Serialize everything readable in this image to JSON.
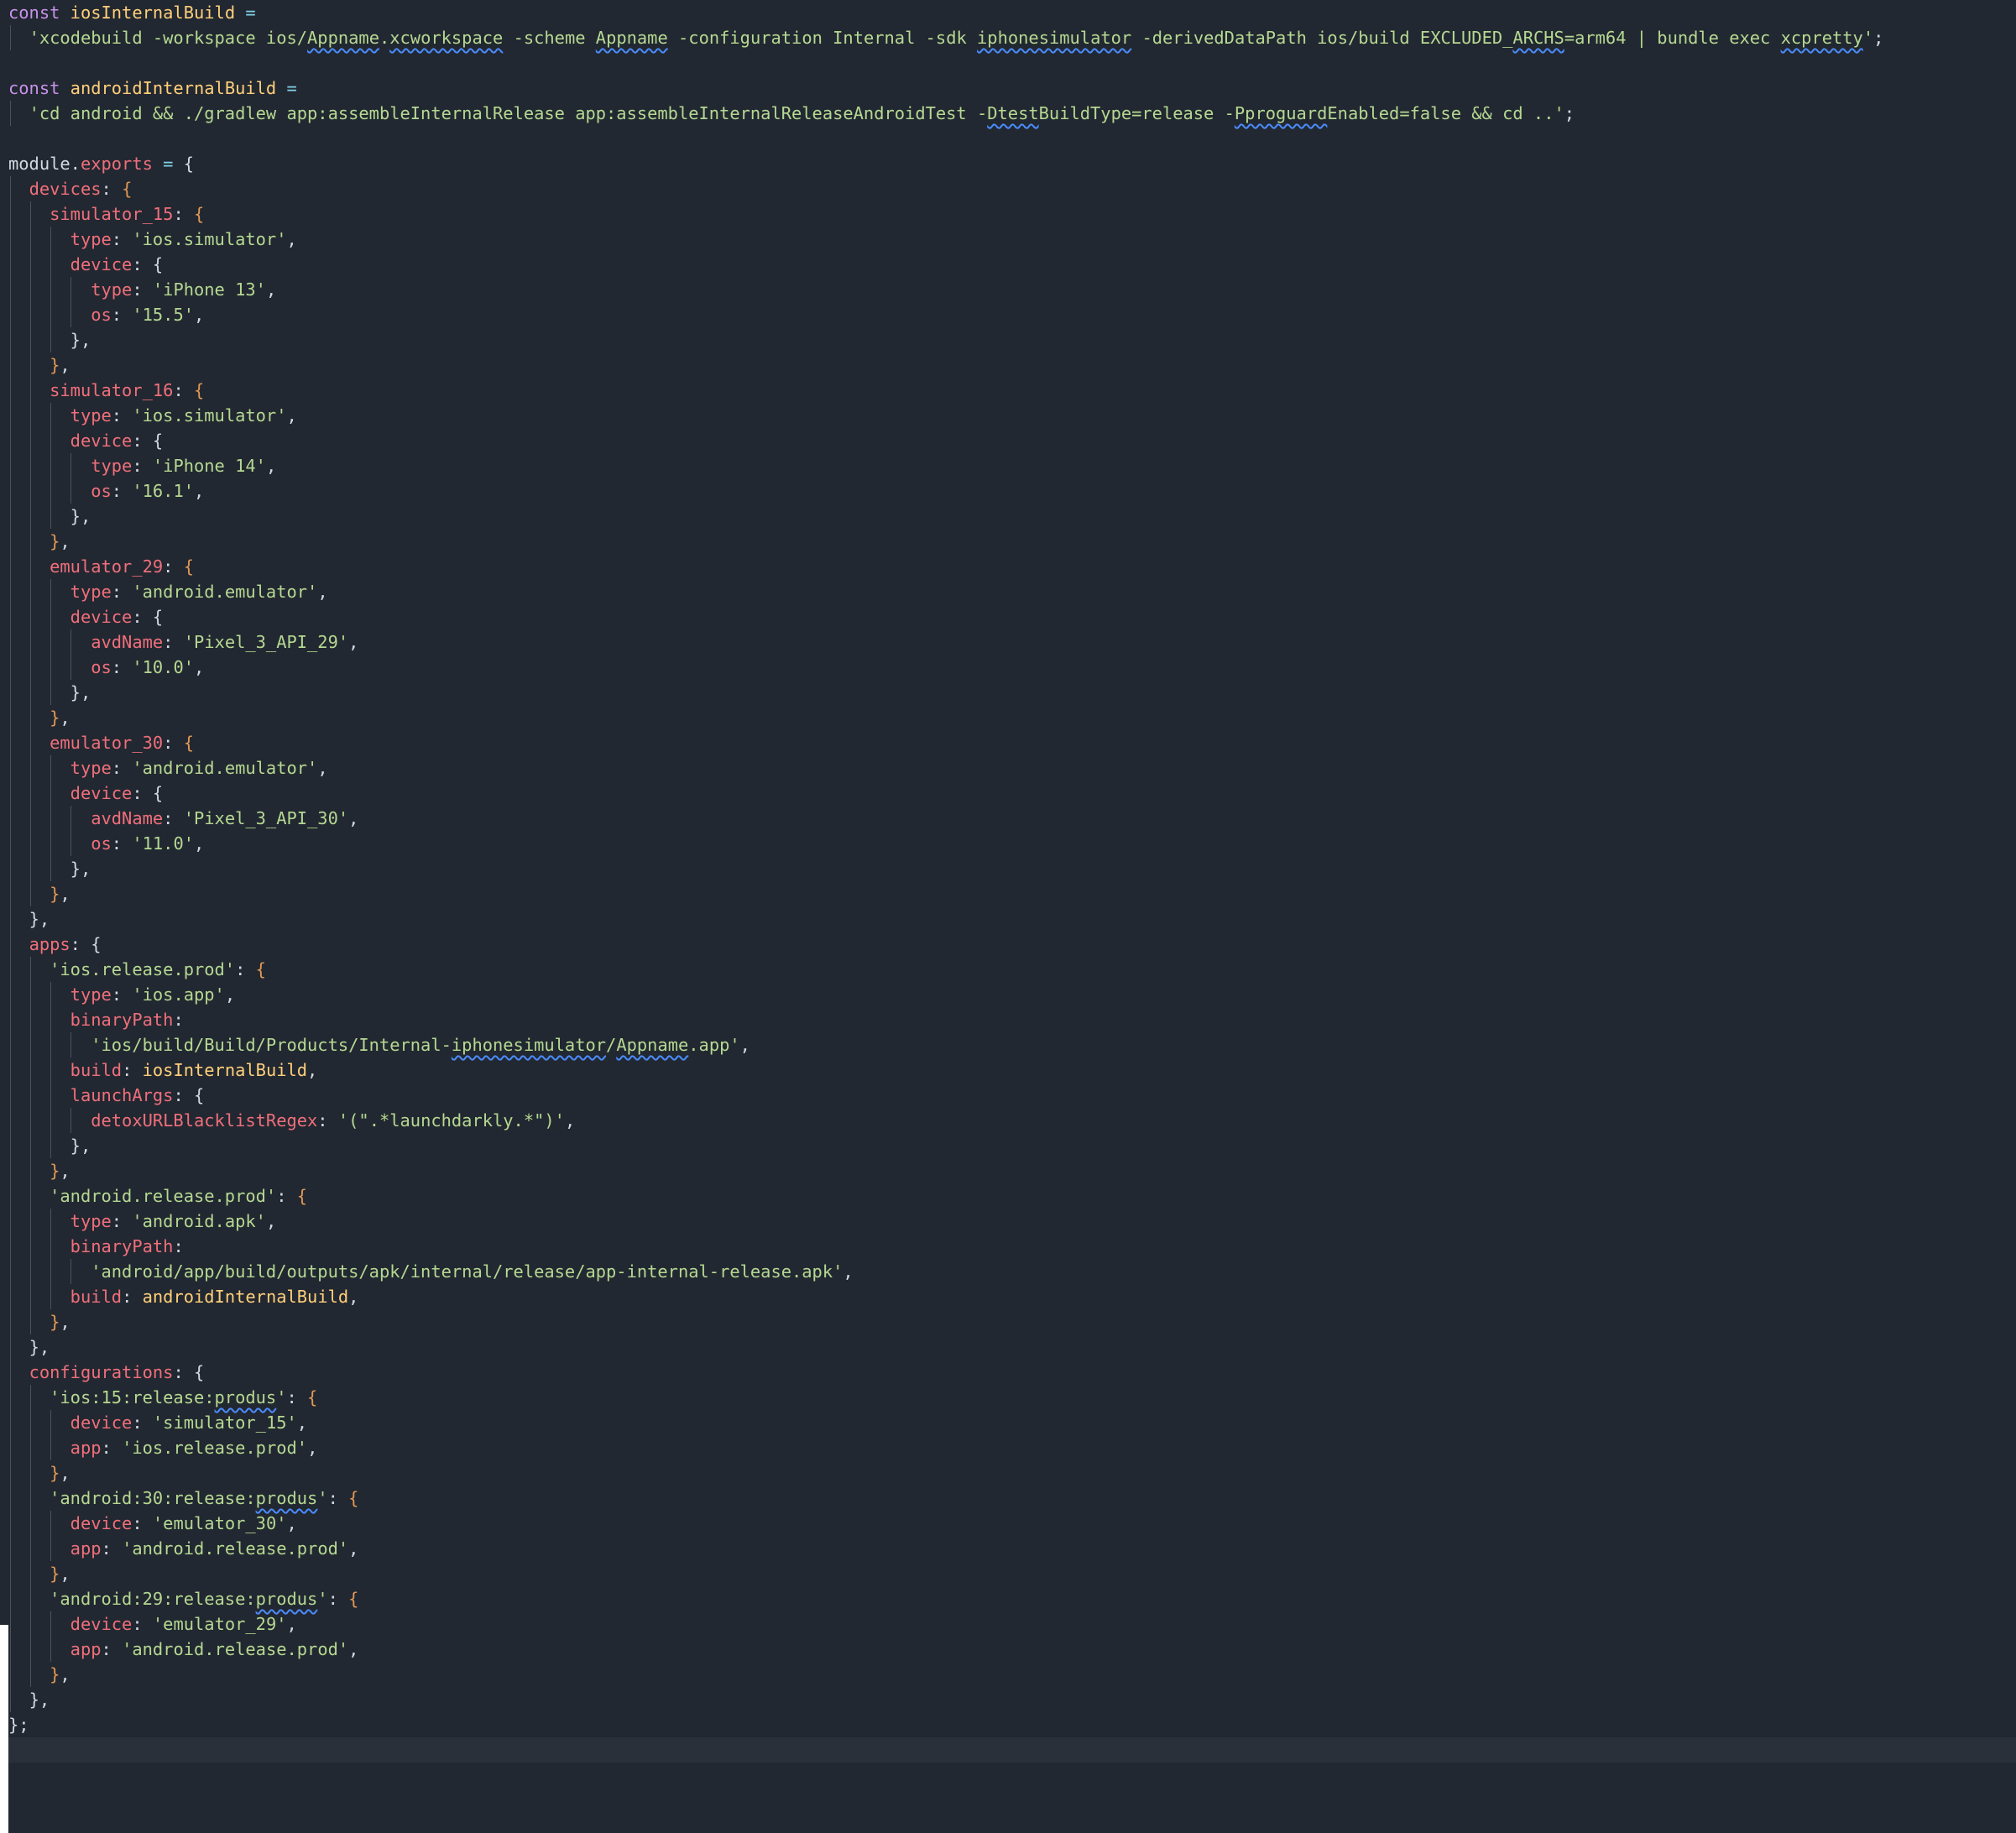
{
  "editor": {
    "lines": [
      [
        {
          "t": "const",
          "c": "kw"
        },
        {
          "t": " "
        },
        {
          "t": "iosInternalBuild",
          "c": "cn"
        },
        {
          "t": " =",
          " c": "op"
        }
      ],
      [
        {
          "t": "  "
        },
        {
          "t": "'xcodebuild -workspace ios/",
          "c": "st"
        },
        {
          "t": "Appname",
          "c": "st",
          "sq": true
        },
        {
          "t": ".",
          "c": "st"
        },
        {
          "t": "xcworkspace",
          "c": "st",
          "sq": true
        },
        {
          "t": " -scheme ",
          "c": "st"
        },
        {
          "t": "Appname",
          "c": "st",
          "sq": true
        },
        {
          "t": " -configuration Internal -sdk ",
          "c": "st"
        },
        {
          "t": "iphonesimulator",
          "c": "st",
          "sq": true
        },
        {
          "t": " -derivedDataPath ios/build EXCLUDED_",
          "c": "st"
        },
        {
          "t": "ARCHS",
          "c": "st",
          "sq": true
        },
        {
          "t": "=arm64 | bundle exec ",
          "c": "st"
        },
        {
          "t": "xcpretty",
          "c": "st",
          "sq": true
        },
        {
          "t": "'",
          "c": "st"
        },
        {
          "t": ";",
          "c": "pu"
        }
      ],
      [],
      [
        {
          "t": "const",
          "c": "kw"
        },
        {
          "t": " "
        },
        {
          "t": "androidInternalBuild",
          "c": "cn"
        },
        {
          "t": " =",
          "c": "op"
        }
      ],
      [
        {
          "t": "  "
        },
        {
          "t": "'cd android && ./gradlew app:assembleInternalRelease app:assembleInternalReleaseAndroidTest -",
          "c": "st"
        },
        {
          "t": "Dtest",
          "c": "st",
          "sq": true
        },
        {
          "t": "BuildType=release -",
          "c": "st"
        },
        {
          "t": "Pproguard",
          "c": "st",
          "sq": true
        },
        {
          "t": "Enabled=false && cd ..'",
          "c": "st"
        },
        {
          "t": ";",
          "c": "pu"
        }
      ],
      [],
      [
        {
          "t": "module",
          "c": "pu"
        },
        {
          "t": ".",
          "c": "pu"
        },
        {
          "t": "exports",
          "c": "pr"
        },
        {
          "t": " = ",
          "c": "op"
        },
        {
          "t": "{",
          "c": "pu"
        }
      ],
      [
        {
          "t": "  "
        },
        {
          "t": "devices",
          "c": "pr"
        },
        {
          "t": ": ",
          "c": "pu"
        },
        {
          "t": "{",
          "c": "b2"
        }
      ],
      [
        {
          "t": "    "
        },
        {
          "t": "simulator_15",
          "c": "pr"
        },
        {
          "t": ": ",
          "c": "pu"
        },
        {
          "t": "{",
          "c": "b2"
        }
      ],
      [
        {
          "t": "      "
        },
        {
          "t": "type",
          "c": "pr"
        },
        {
          "t": ": ",
          "c": "pu"
        },
        {
          "t": "'ios.simulator'",
          "c": "st"
        },
        {
          "t": ",",
          "c": "pu"
        }
      ],
      [
        {
          "t": "      "
        },
        {
          "t": "device",
          "c": "pr"
        },
        {
          "t": ": {",
          "c": "pu"
        }
      ],
      [
        {
          "t": "        "
        },
        {
          "t": "type",
          "c": "pr"
        },
        {
          "t": ": ",
          "c": "pu"
        },
        {
          "t": "'iPhone 13'",
          "c": "st"
        },
        {
          "t": ",",
          "c": "pu"
        }
      ],
      [
        {
          "t": "        "
        },
        {
          "t": "os",
          "c": "pr"
        },
        {
          "t": ": ",
          "c": "pu"
        },
        {
          "t": "'15.5'",
          "c": "st"
        },
        {
          "t": ",",
          "c": "pu"
        }
      ],
      [
        {
          "t": "      "
        },
        {
          "t": "},",
          "c": "pu"
        }
      ],
      [
        {
          "t": "    "
        },
        {
          "t": "}",
          "c": "b2"
        },
        {
          "t": ",",
          "c": "pu"
        }
      ],
      [
        {
          "t": "    "
        },
        {
          "t": "simulator_16",
          "c": "pr"
        },
        {
          "t": ": ",
          "c": "pu"
        },
        {
          "t": "{",
          "c": "b2"
        }
      ],
      [
        {
          "t": "      "
        },
        {
          "t": "type",
          "c": "pr"
        },
        {
          "t": ": ",
          "c": "pu"
        },
        {
          "t": "'ios.simulator'",
          "c": "st"
        },
        {
          "t": ",",
          "c": "pu"
        }
      ],
      [
        {
          "t": "      "
        },
        {
          "t": "device",
          "c": "pr"
        },
        {
          "t": ": {",
          "c": "pu"
        }
      ],
      [
        {
          "t": "        "
        },
        {
          "t": "type",
          "c": "pr"
        },
        {
          "t": ": ",
          "c": "pu"
        },
        {
          "t": "'iPhone 14'",
          "c": "st"
        },
        {
          "t": ",",
          "c": "pu"
        }
      ],
      [
        {
          "t": "        "
        },
        {
          "t": "os",
          "c": "pr"
        },
        {
          "t": ": ",
          "c": "pu"
        },
        {
          "t": "'16.1'",
          "c": "st"
        },
        {
          "t": ",",
          "c": "pu"
        }
      ],
      [
        {
          "t": "      "
        },
        {
          "t": "},",
          "c": "pu"
        }
      ],
      [
        {
          "t": "    "
        },
        {
          "t": "}",
          "c": "b2"
        },
        {
          "t": ",",
          "c": "pu"
        }
      ],
      [
        {
          "t": "    "
        },
        {
          "t": "emulator_29",
          "c": "pr"
        },
        {
          "t": ": ",
          "c": "pu"
        },
        {
          "t": "{",
          "c": "b2"
        }
      ],
      [
        {
          "t": "      "
        },
        {
          "t": "type",
          "c": "pr"
        },
        {
          "t": ": ",
          "c": "pu"
        },
        {
          "t": "'android.emulator'",
          "c": "st"
        },
        {
          "t": ",",
          "c": "pu"
        }
      ],
      [
        {
          "t": "      "
        },
        {
          "t": "device",
          "c": "pr"
        },
        {
          "t": ": {",
          "c": "pu"
        }
      ],
      [
        {
          "t": "        "
        },
        {
          "t": "avdName",
          "c": "pr"
        },
        {
          "t": ": ",
          "c": "pu"
        },
        {
          "t": "'Pixel_3_API_29'",
          "c": "st"
        },
        {
          "t": ",",
          "c": "pu"
        }
      ],
      [
        {
          "t": "        "
        },
        {
          "t": "os",
          "c": "pr"
        },
        {
          "t": ": ",
          "c": "pu"
        },
        {
          "t": "'10.0'",
          "c": "st"
        },
        {
          "t": ",",
          "c": "pu"
        }
      ],
      [
        {
          "t": "      "
        },
        {
          "t": "},",
          "c": "pu"
        }
      ],
      [
        {
          "t": "    "
        },
        {
          "t": "}",
          "c": "b2"
        },
        {
          "t": ",",
          "c": "pu"
        }
      ],
      [
        {
          "t": "    "
        },
        {
          "t": "emulator_30",
          "c": "pr"
        },
        {
          "t": ": ",
          "c": "pu"
        },
        {
          "t": "{",
          "c": "b2"
        }
      ],
      [
        {
          "t": "      "
        },
        {
          "t": "type",
          "c": "pr"
        },
        {
          "t": ": ",
          "c": "pu"
        },
        {
          "t": "'android.emulator'",
          "c": "st"
        },
        {
          "t": ",",
          "c": "pu"
        }
      ],
      [
        {
          "t": "      "
        },
        {
          "t": "device",
          "c": "pr"
        },
        {
          "t": ": {",
          "c": "pu"
        }
      ],
      [
        {
          "t": "        "
        },
        {
          "t": "avdName",
          "c": "pr"
        },
        {
          "t": ": ",
          "c": "pu"
        },
        {
          "t": "'Pixel_3_API_30'",
          "c": "st"
        },
        {
          "t": ",",
          "c": "pu"
        }
      ],
      [
        {
          "t": "        "
        },
        {
          "t": "os",
          "c": "pr"
        },
        {
          "t": ": ",
          "c": "pu"
        },
        {
          "t": "'11.0'",
          "c": "st"
        },
        {
          "t": ",",
          "c": "pu"
        }
      ],
      [
        {
          "t": "      "
        },
        {
          "t": "},",
          "c": "pu"
        }
      ],
      [
        {
          "t": "    "
        },
        {
          "t": "}",
          "c": "b2"
        },
        {
          "t": ",",
          "c": "pu"
        }
      ],
      [
        {
          "t": "  "
        },
        {
          "t": "},",
          "c": "pu"
        }
      ],
      [
        {
          "t": "  "
        },
        {
          "t": "apps",
          "c": "pr"
        },
        {
          "t": ": {",
          "c": "pu"
        }
      ],
      [
        {
          "t": "    "
        },
        {
          "t": "'ios.release.prod'",
          "c": "st"
        },
        {
          "t": ": ",
          "c": "pu"
        },
        {
          "t": "{",
          "c": "b2"
        }
      ],
      [
        {
          "t": "      "
        },
        {
          "t": "type",
          "c": "pr"
        },
        {
          "t": ": ",
          "c": "pu"
        },
        {
          "t": "'ios.app'",
          "c": "st"
        },
        {
          "t": ",",
          "c": "pu"
        }
      ],
      [
        {
          "t": "      "
        },
        {
          "t": "binaryPath",
          "c": "pr"
        },
        {
          "t": ":",
          "c": "pu"
        }
      ],
      [
        {
          "t": "        "
        },
        {
          "t": "'ios/build/Build/Products/Internal-",
          "c": "st"
        },
        {
          "t": "iphonesimulator",
          "c": "st",
          "sq": true
        },
        {
          "t": "/",
          "c": "st"
        },
        {
          "t": "Appname",
          "c": "st",
          "sq": true
        },
        {
          "t": ".app'",
          "c": "st"
        },
        {
          "t": ",",
          "c": "pu"
        }
      ],
      [
        {
          "t": "      "
        },
        {
          "t": "build",
          "c": "pr"
        },
        {
          "t": ": ",
          "c": "pu"
        },
        {
          "t": "iosInternalBuild",
          "c": "cn"
        },
        {
          "t": ",",
          "c": "pu"
        }
      ],
      [
        {
          "t": "      "
        },
        {
          "t": "launchArgs",
          "c": "pr"
        },
        {
          "t": ": {",
          "c": "pu"
        }
      ],
      [
        {
          "t": "        "
        },
        {
          "t": "detoxURLBlacklistRegex",
          "c": "pr"
        },
        {
          "t": ": ",
          "c": "pu"
        },
        {
          "t": "'(\".*launchdarkly.*\")'",
          "c": "st"
        },
        {
          "t": ",",
          "c": "pu"
        }
      ],
      [
        {
          "t": "      "
        },
        {
          "t": "},",
          "c": "pu"
        }
      ],
      [
        {
          "t": "    "
        },
        {
          "t": "}",
          "c": "b2"
        },
        {
          "t": ",",
          "c": "pu"
        }
      ],
      [
        {
          "t": "    "
        },
        {
          "t": "'android.release.prod'",
          "c": "st"
        },
        {
          "t": ": ",
          "c": "pu"
        },
        {
          "t": "{",
          "c": "b2"
        }
      ],
      [
        {
          "t": "      "
        },
        {
          "t": "type",
          "c": "pr"
        },
        {
          "t": ": ",
          "c": "pu"
        },
        {
          "t": "'android.apk'",
          "c": "st"
        },
        {
          "t": ",",
          "c": "pu"
        }
      ],
      [
        {
          "t": "      "
        },
        {
          "t": "binaryPath",
          "c": "pr"
        },
        {
          "t": ":",
          "c": "pu"
        }
      ],
      [
        {
          "t": "        "
        },
        {
          "t": "'android/app/build/outputs/apk/internal/release/app-internal-release.apk'",
          "c": "st"
        },
        {
          "t": ",",
          "c": "pu"
        }
      ],
      [
        {
          "t": "      "
        },
        {
          "t": "build",
          "c": "pr"
        },
        {
          "t": ": ",
          "c": "pu"
        },
        {
          "t": "androidInternalBuild",
          "c": "cn"
        },
        {
          "t": ",",
          "c": "pu"
        }
      ],
      [
        {
          "t": "    "
        },
        {
          "t": "}",
          "c": "b2"
        },
        {
          "t": ",",
          "c": "pu"
        }
      ],
      [
        {
          "t": "  "
        },
        {
          "t": "},",
          "c": "pu"
        }
      ],
      [
        {
          "t": "  "
        },
        {
          "t": "configurations",
          "c": "pr"
        },
        {
          "t": ": {",
          "c": "pu"
        }
      ],
      [
        {
          "t": "    "
        },
        {
          "t": "'ios:15:release:",
          "c": "st"
        },
        {
          "t": "produs",
          "c": "st",
          "sq": true
        },
        {
          "t": "'",
          "c": "st"
        },
        {
          "t": ": ",
          "c": "pu"
        },
        {
          "t": "{",
          "c": "b2"
        }
      ],
      [
        {
          "t": "      "
        },
        {
          "t": "device",
          "c": "pr"
        },
        {
          "t": ": ",
          "c": "pu"
        },
        {
          "t": "'simulator_15'",
          "c": "st"
        },
        {
          "t": ",",
          "c": "pu"
        }
      ],
      [
        {
          "t": "      "
        },
        {
          "t": "app",
          "c": "pr"
        },
        {
          "t": ": ",
          "c": "pu"
        },
        {
          "t": "'ios.release.prod'",
          "c": "st"
        },
        {
          "t": ",",
          "c": "pu"
        }
      ],
      [
        {
          "t": "    "
        },
        {
          "t": "}",
          "c": "b2"
        },
        {
          "t": ",",
          "c": "pu"
        }
      ],
      [
        {
          "t": "    "
        },
        {
          "t": "'android:30:release:",
          "c": "st"
        },
        {
          "t": "produs",
          "c": "st",
          "sq": true
        },
        {
          "t": "'",
          "c": "st"
        },
        {
          "t": ": ",
          "c": "pu"
        },
        {
          "t": "{",
          "c": "b2"
        }
      ],
      [
        {
          "t": "      "
        },
        {
          "t": "device",
          "c": "pr"
        },
        {
          "t": ": ",
          "c": "pu"
        },
        {
          "t": "'emulator_30'",
          "c": "st"
        },
        {
          "t": ",",
          "c": "pu"
        }
      ],
      [
        {
          "t": "      "
        },
        {
          "t": "app",
          "c": "pr"
        },
        {
          "t": ": ",
          "c": "pu"
        },
        {
          "t": "'android.release.prod'",
          "c": "st"
        },
        {
          "t": ",",
          "c": "pu"
        }
      ],
      [
        {
          "t": "    "
        },
        {
          "t": "}",
          "c": "b2"
        },
        {
          "t": ",",
          "c": "pu"
        }
      ],
      [
        {
          "t": "    "
        },
        {
          "t": "'android:29:release:",
          "c": "st"
        },
        {
          "t": "produs",
          "c": "st",
          "sq": true
        },
        {
          "t": "'",
          "c": "st"
        },
        {
          "t": ": ",
          "c": "pu"
        },
        {
          "t": "{",
          "c": "b2"
        }
      ],
      [
        {
          "t": "      "
        },
        {
          "t": "device",
          "c": "pr"
        },
        {
          "t": ": ",
          "c": "pu"
        },
        {
          "t": "'emulator_29'",
          "c": "st"
        },
        {
          "t": ",",
          "c": "pu"
        }
      ],
      [
        {
          "t": "      "
        },
        {
          "t": "app",
          "c": "pr"
        },
        {
          "t": ": ",
          "c": "pu"
        },
        {
          "t": "'android.release.prod'",
          "c": "st"
        },
        {
          "t": ",",
          "c": "pu"
        }
      ],
      [
        {
          "t": "    "
        },
        {
          "t": "}",
          "c": "b2"
        },
        {
          "t": ",",
          "c": "pu"
        }
      ],
      [
        {
          "t": "  "
        },
        {
          "t": "},",
          "c": "pu"
        }
      ],
      [
        {
          "t": "};",
          "c": "pu"
        }
      ]
    ]
  },
  "colors": {
    "background": "#222831",
    "keyword": "#c792ea",
    "constant": "#ffcf7a",
    "operator": "#7fd3e6",
    "property": "#ef6f7b",
    "string": "#b5d892",
    "punctuation": "#d3d9e1",
    "bracket_level_2": "#e09854",
    "squiggle": "#4a8cff"
  }
}
